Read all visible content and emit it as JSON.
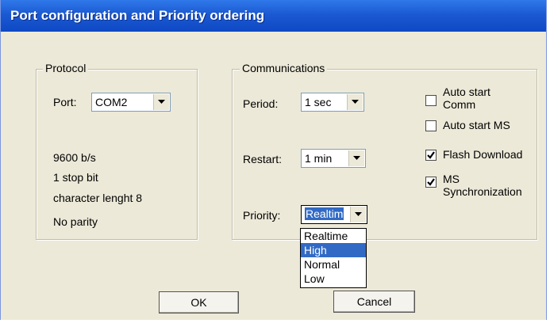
{
  "window": {
    "title": "Port configuration and Priority ordering"
  },
  "protocol": {
    "legend": "Protocol",
    "port_label": "Port:",
    "port_value": "COM2",
    "info": [
      "9600 b/s",
      "1 stop bit",
      "character lenght 8",
      "No  parity"
    ]
  },
  "communications": {
    "legend": "Communications",
    "period_label": "Period:",
    "period_value": "1 sec",
    "restart_label": "Restart:",
    "restart_value": "1 min",
    "priority_label": "Priority:",
    "priority_value": "Realtim",
    "priority_options": [
      "Realtime",
      "High",
      "Normal",
      "Low"
    ],
    "priority_highlighted": "High",
    "checkboxes": [
      {
        "label_line1": "Auto start",
        "label_line2": "Comm",
        "checked": false
      },
      {
        "label_line1": "Auto start MS",
        "label_line2": "",
        "checked": false
      },
      {
        "label_line1": "Flash Download",
        "label_line2": "",
        "checked": true
      },
      {
        "label_line1": "MS",
        "label_line2": "Synchronization",
        "checked": true
      }
    ]
  },
  "buttons": {
    "ok": "OK",
    "cancel": "Cancel"
  },
  "colors": {
    "titlebar": "#1b59d2",
    "dialog_bg": "#ece9d8",
    "selection": "#316ac5"
  }
}
